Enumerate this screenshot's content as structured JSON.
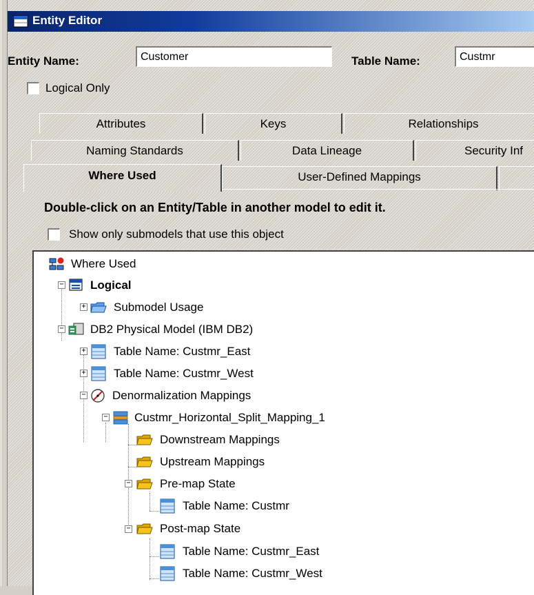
{
  "window": {
    "title": "Entity Editor"
  },
  "form": {
    "entity_name_label": "Entity Name:",
    "entity_name_value": "Customer",
    "table_name_label": "Table Name:",
    "table_name_value": "Custmr",
    "logical_only_label": "Logical Only",
    "logical_only_checked": false
  },
  "tabs": {
    "row1": [
      "Attributes",
      "Keys",
      "Relationships"
    ],
    "row2": [
      "Naming Standards",
      "Data Lineage",
      "Security Inf"
    ],
    "row3": [
      "Where Used",
      "User-Defined Mappings"
    ],
    "active": "Where Used"
  },
  "where_used": {
    "instruction": "Double-click on an Entity/Table in another model to edit it.",
    "show_only_label": "Show only submodels that use this object",
    "show_only_checked": false
  },
  "tree": {
    "root": "Where Used",
    "logical": "Logical",
    "submodel_usage": "Submodel Usage",
    "physical_model": "DB2 Physical Model (IBM DB2)",
    "table_east": "Table Name: Custmr_East",
    "table_west": "Table Name: Custmr_West",
    "denorm": "Denormalization Mappings",
    "mapping": "Custmr_Horizontal_Split_Mapping_1",
    "downstream": "Downstream Mappings",
    "upstream": "Upstream Mappings",
    "premap": "Pre-map State",
    "premap_table": "Table Name: Custmr",
    "postmap": "Post-map State",
    "postmap_table_east": "Table Name: Custmr_East",
    "postmap_table_west": "Table Name: Custmr_West"
  },
  "icons": {
    "title": "window-icon",
    "root": "where-used-icon",
    "logical": "logical-model-icon",
    "physical": "physical-model-icon",
    "table": "table-icon",
    "folder": "folder-icon",
    "denorm": "compass-icon",
    "mapping": "mapping-icon"
  },
  "colors": {
    "titlebar_start": "#0a246a",
    "titlebar_end": "#a6caf0",
    "face": "#d4d0c8",
    "folder": "#f5c518",
    "table_header": "#4a90d9"
  }
}
